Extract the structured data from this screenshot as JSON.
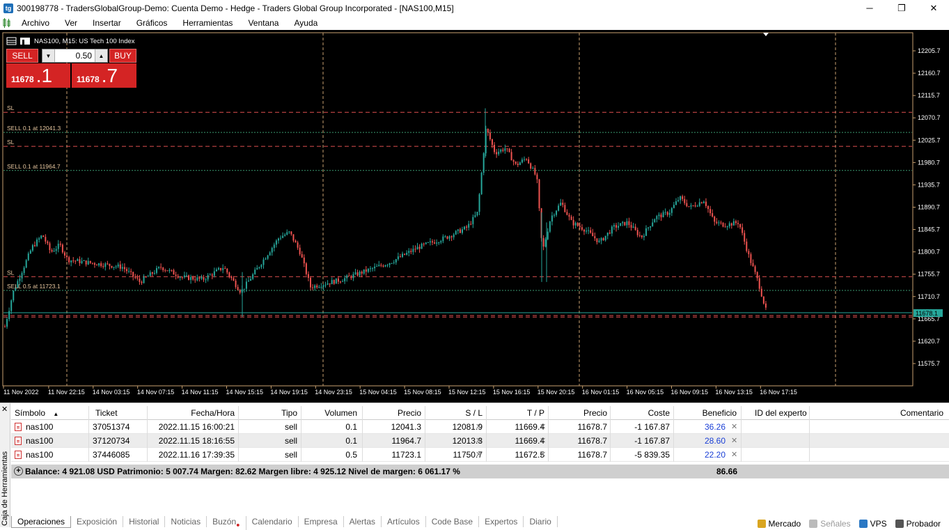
{
  "window": {
    "title": "300198778 - TradersGlobalGroup-Demo: Cuenta Demo - Hedge - Traders Global Group Incorporated - [NAS100,M15]",
    "icon_text": "tg",
    "minimize": "─",
    "maximize": "❐",
    "close": "✕"
  },
  "menu": [
    "Archivo",
    "Ver",
    "Insertar",
    "Gráficos",
    "Herramientas",
    "Ventana",
    "Ayuda"
  ],
  "chart": {
    "symbol_title": "NAS100, M15:  US Tech 100 Index",
    "price_labels": [
      "12205.7",
      "12160.7",
      "12115.7",
      "12070.7",
      "12025.7",
      "11980.7",
      "11935.7",
      "11890.7",
      "11845.7",
      "11800.7",
      "11755.7",
      "11710.7",
      "11665.7",
      "11620.7",
      "11575.7"
    ],
    "current_price": "11678.1",
    "time_labels": [
      "11 Nov 2022",
      "11 Nov 22:15",
      "14 Nov 03:15",
      "14 Nov 07:15",
      "14 Nov 11:15",
      "14 Nov 15:15",
      "14 Nov 19:15",
      "14 Nov 23:15",
      "15 Nov 04:15",
      "15 Nov 08:15",
      "15 Nov 12:15",
      "15 Nov 16:15",
      "15 Nov 20:15",
      "16 Nov 01:15",
      "16 Nov 05:15",
      "16 Nov 09:15",
      "16 Nov 13:15",
      "16 Nov 17:15"
    ],
    "order_labels": [
      "SL",
      "SELL 0.1 at 12041.3",
      "SL",
      "SELL 0.1 at 11964.7",
      "SL",
      "SELL 0.5 at 11723.1"
    ],
    "bull_color": "#26a69a",
    "bear_color": "#ef5350"
  },
  "trade_panel": {
    "sell_label": "SELL",
    "buy_label": "BUY",
    "lot": "0.50",
    "sell_price_small": "11678",
    "sell_price_big": ".1",
    "buy_price_small": "11678",
    "buy_price_big": ".7",
    "spin_down": "▼",
    "spin_up": "▲"
  },
  "toolbox": {
    "side_label": "Caja de Herramientas",
    "close": "✕",
    "headers": {
      "symbol": "Símbolo",
      "sort": "▲",
      "ticket": "Ticket",
      "time": "Fecha/Hora",
      "type": "Tipo",
      "volume": "Volumen",
      "price": "Precio",
      "sl": "S / L",
      "tp": "T / P",
      "price2": "Precio",
      "cost": "Coste",
      "profit": "Beneficio",
      "expert": "ID del experto",
      "comment": "Comentario"
    },
    "rows": [
      {
        "symbol": "nas100",
        "ticket": "37051374",
        "time": "2022.11.15 16:00:21",
        "type": "sell",
        "volume": "0.1",
        "price": "12041.3",
        "sl": "12081.9",
        "tp": "11669.4",
        "price2": "11678.7",
        "cost": "-1 167.87",
        "profit": "36.26"
      },
      {
        "symbol": "nas100",
        "ticket": "37120734",
        "time": "2022.11.15 18:16:55",
        "type": "sell",
        "volume": "0.1",
        "price": "11964.7",
        "sl": "12013.3",
        "tp": "11669.4",
        "price2": "11678.7",
        "cost": "-1 167.87",
        "profit": "28.60"
      },
      {
        "symbol": "nas100",
        "ticket": "37446085",
        "time": "2022.11.16 17:39:35",
        "type": "sell",
        "volume": "0.5",
        "price": "11723.1",
        "sl": "11750.7",
        "tp": "11672.5",
        "price2": "11678.7",
        "cost": "-5 839.35",
        "profit": "22.20"
      }
    ],
    "x_mark": "✕",
    "summary": {
      "plus": "+",
      "text": "Balance: 4 921.08 USD  Patrimonio: 5 007.74  Margen: 82.62  Margen libre: 4 925.12  Nivel de margen: 6 061.17 %",
      "total": "86.66"
    },
    "tabs": [
      "Operaciones",
      "Exposición",
      "Historial",
      "Noticias",
      "Buzón",
      "Calendario",
      "Empresa",
      "Alertas",
      "Artículos",
      "Code Base",
      "Expertos",
      "Diario"
    ],
    "status": [
      {
        "label": "Mercado",
        "icon": "market-icon",
        "color": "#d9a520",
        "disabled": false
      },
      {
        "label": "Señales",
        "icon": "signals-icon",
        "color": "#bbbbbb",
        "disabled": true
      },
      {
        "label": "VPS",
        "icon": "vps-icon",
        "color": "#2b78c4",
        "disabled": false
      },
      {
        "label": "Probador",
        "icon": "tester-icon",
        "color": "#555555",
        "disabled": false
      }
    ]
  }
}
